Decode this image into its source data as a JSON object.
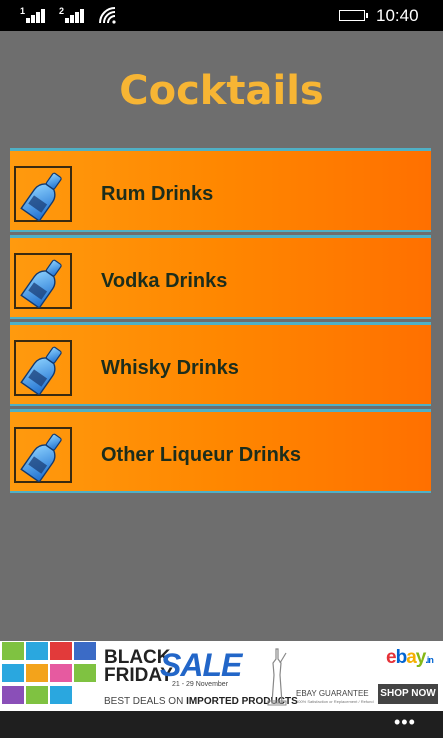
{
  "status_bar": {
    "sim1": "1",
    "sim2": "2",
    "time": "10:40",
    "icons": [
      "signal-icon",
      "signal-icon",
      "wifi-icon",
      "battery-icon"
    ]
  },
  "app": {
    "title": "Cocktails",
    "title_color": "#f7b534",
    "background": "#6e6e6e",
    "menu": [
      {
        "label": "Rum Drinks",
        "icon": "bottle-icon"
      },
      {
        "label": "Vodka Drinks",
        "icon": "bottle-icon"
      },
      {
        "label": "Whisky Drinks",
        "icon": "bottle-icon"
      },
      {
        "label": "Other Liqueur Drinks",
        "icon": "bottle-icon"
      }
    ]
  },
  "ad": {
    "headline_line1": "BLACK",
    "headline_line2": "FRIDAY",
    "sale": "SALE",
    "dates": "21 - 29 November",
    "deals_prefix": "BEST DEALS ON ",
    "deals_highlight": "IMPORTED PRODUCTS",
    "brand": "ebay",
    "brand_suffix": ".in",
    "guarantee": "EBAY GUARANTEE",
    "guarantee_sub": "100% Satisfaction or Replacement / Refund",
    "cta": "SHOP NOW"
  },
  "app_bar": {
    "more": "•••"
  }
}
